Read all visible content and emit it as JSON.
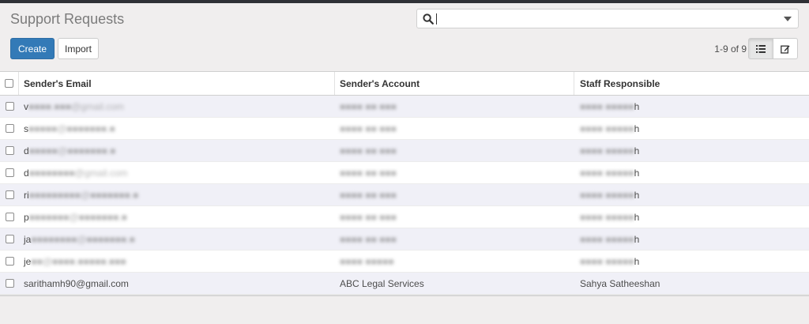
{
  "page": {
    "title": "Support Requests"
  },
  "search": {
    "placeholder": "",
    "value": ""
  },
  "toolbar": {
    "create_label": "Create",
    "import_label": "Import"
  },
  "pager": {
    "range": "1-9 of 9"
  },
  "view_switcher": {
    "active": "list",
    "icons": [
      "list-view-icon",
      "form-view-icon"
    ]
  },
  "colors": {
    "primary": "#337ab7",
    "row_alt": "#f0f0f7",
    "topbar": "#2f3136"
  },
  "table": {
    "headers": {
      "email": "Sender's Email",
      "account": "Sender's Account",
      "staff": "Staff Responsible"
    },
    "rows": [
      {
        "email": "v",
        "email_blur": "■■■■.■■■@gmail.com",
        "account": "",
        "account_blur": "■■■■ ■■ ■■■",
        "staff": "h",
        "staff_blur": "■■■■ ■■■■■"
      },
      {
        "email": "s",
        "email_blur": "■■■■■@■■■■■■■.■",
        "account": "",
        "account_blur": "■■■■ ■■ ■■■",
        "staff": "h",
        "staff_blur": "■■■■ ■■■■■"
      },
      {
        "email": "d",
        "email_blur": "■■■■■@■■■■■■■.■",
        "account": "",
        "account_blur": "■■■■ ■■ ■■■",
        "staff": "h",
        "staff_blur": "■■■■ ■■■■■"
      },
      {
        "email": "d",
        "email_blur": "■■■■■■■■@gmail.com",
        "account": "",
        "account_blur": "■■■■ ■■ ■■■",
        "staff": "h",
        "staff_blur": "■■■■ ■■■■■"
      },
      {
        "email": "ri",
        "email_blur": "■■■■■■■■■@■■■■■■■.■",
        "account": "",
        "account_blur": "■■■■ ■■ ■■■",
        "staff": "h",
        "staff_blur": "■■■■ ■■■■■"
      },
      {
        "email": "p",
        "email_blur": "■■■■■■■@■■■■■■■.■",
        "account": "",
        "account_blur": "■■■■ ■■ ■■■",
        "staff": "h",
        "staff_blur": "■■■■ ■■■■■"
      },
      {
        "email": "ja",
        "email_blur": "■■■■■■■■@■■■■■■■.■",
        "account": "",
        "account_blur": "■■■■ ■■ ■■■",
        "staff": "h",
        "staff_blur": "■■■■ ■■■■■"
      },
      {
        "email": "je",
        "email_blur": "■■@■■■■.■■■■■.■■■",
        "account": "",
        "account_blur": "■■■■ ■■■■■",
        "staff": "h",
        "staff_blur": "■■■■ ■■■■■"
      },
      {
        "email": "sarithamh90@gmail.com",
        "email_blur": "",
        "account": "ABC Legal Services",
        "account_blur": "",
        "staff": "Sahya Satheeshan",
        "staff_blur": ""
      }
    ]
  }
}
